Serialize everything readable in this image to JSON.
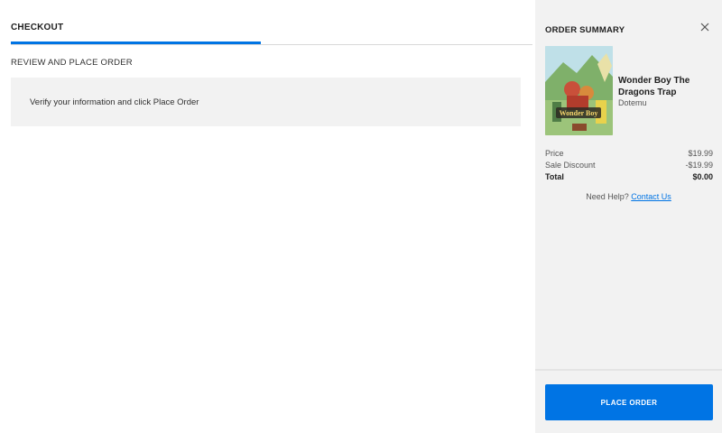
{
  "checkout": {
    "tab_label": "CHECKOUT",
    "section_title": "REVIEW AND PLACE ORDER",
    "info_text": "Verify your information and click Place Order"
  },
  "summary": {
    "title": "ORDER SUMMARY",
    "close_icon": "close-icon",
    "product": {
      "title": "Wonder Boy The Dragons Trap",
      "publisher": "Dotemu",
      "cover_text": "Wonder Boy"
    },
    "price_label": "Price",
    "price_value": "$19.99",
    "discount_label": "Sale Discount",
    "discount_value": "-$19.99",
    "total_label": "Total",
    "total_value": "$0.00",
    "help_text": "Need Help?",
    "help_link": "Contact Us",
    "place_order_label": "PLACE ORDER"
  },
  "colors": {
    "accent": "#0074e4",
    "panel": "#f2f2f2"
  }
}
